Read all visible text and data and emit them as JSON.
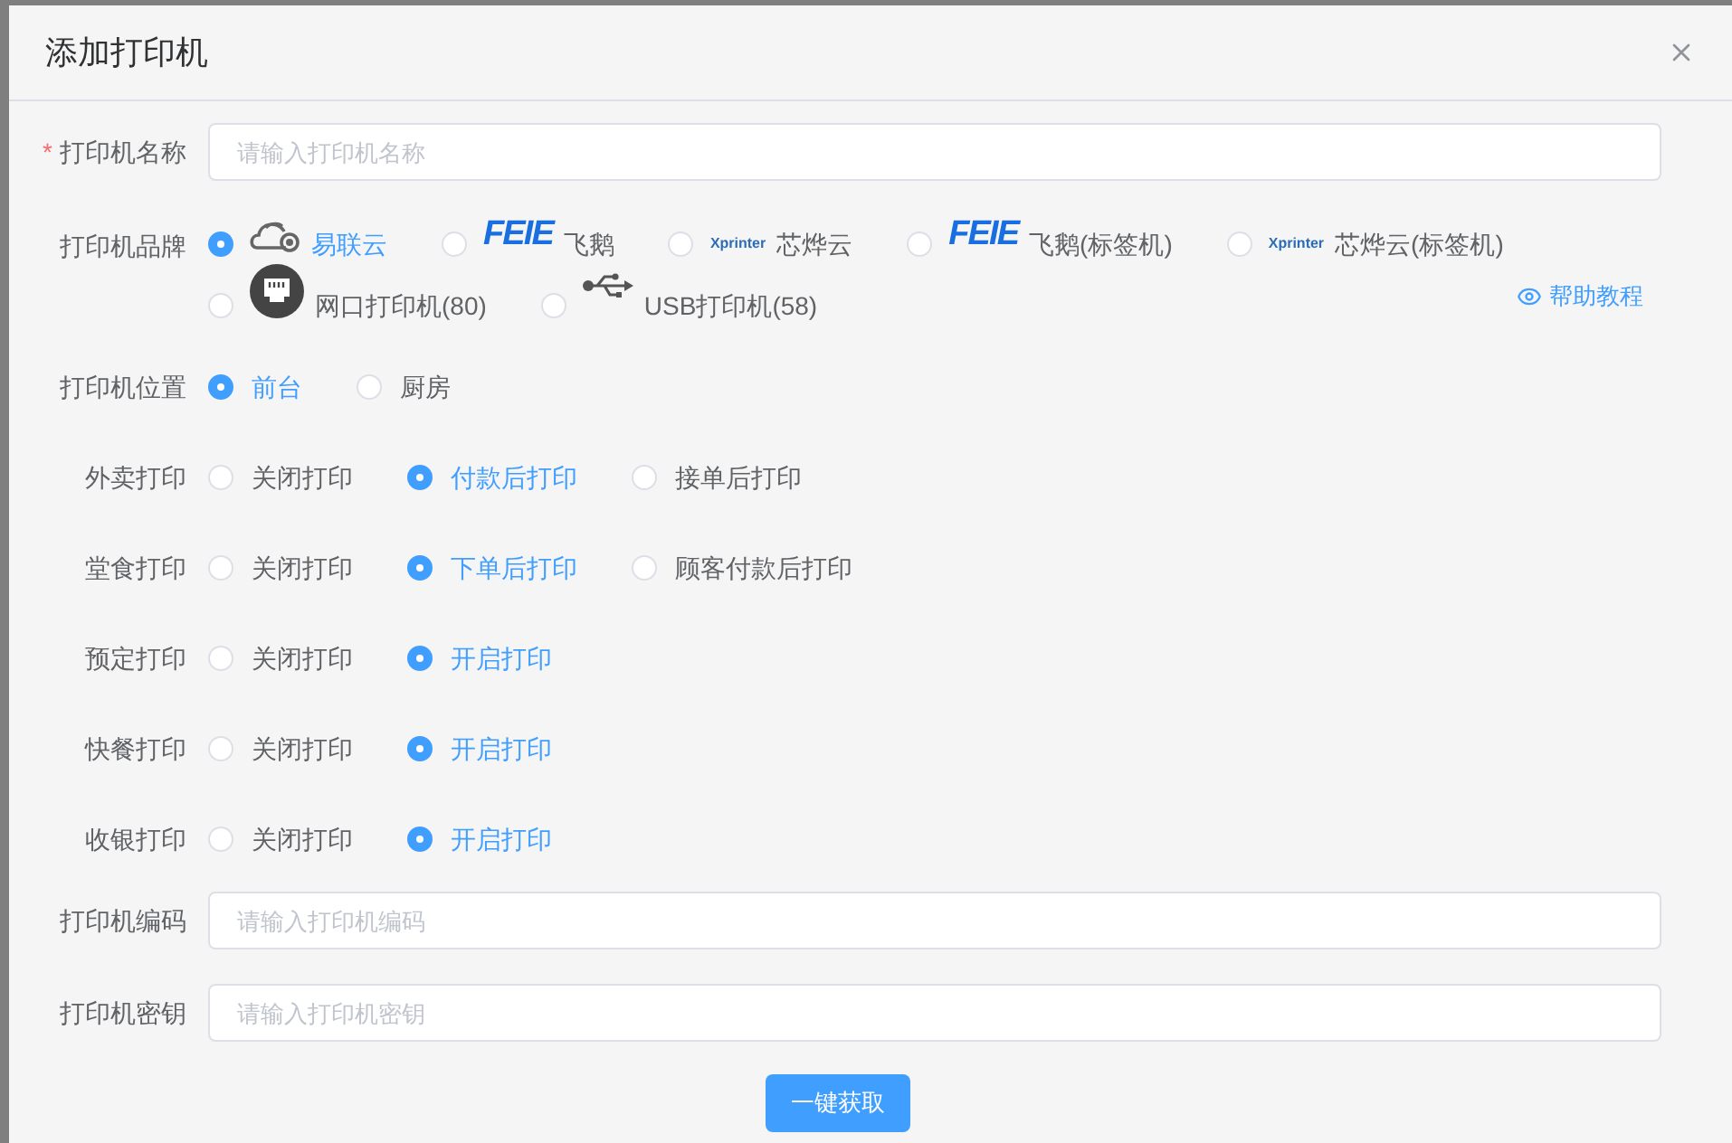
{
  "dialog": {
    "title": "添加打印机"
  },
  "name_field": {
    "required_mark": "*",
    "label": "打印机名称",
    "placeholder": "请输入打印机名称"
  },
  "brand": {
    "label": "打印机品牌",
    "options": [
      {
        "kind": "cloud",
        "name": "易联云",
        "selected": true
      },
      {
        "kind": "feie",
        "logo": "FEIE",
        "name": "飞鹅",
        "selected": false
      },
      {
        "kind": "xprinter",
        "logo": "Xprinter",
        "name": "芯烨云",
        "selected": false
      },
      {
        "kind": "feie",
        "logo": "FEIE",
        "name": "飞鹅(标签机)",
        "selected": false
      },
      {
        "kind": "xprinter",
        "logo": "Xprinter",
        "name": "芯烨云(标签机)",
        "selected": false
      },
      {
        "kind": "ethernet",
        "name": "网口打印机(80)",
        "selected": false
      },
      {
        "kind": "usb",
        "name": "USB打印机(58)",
        "selected": false
      }
    ],
    "help": "帮助教程"
  },
  "radio_groups": [
    {
      "label": "打印机位置",
      "options": [
        {
          "label": "前台",
          "selected": true
        },
        {
          "label": "厨房",
          "selected": false
        }
      ]
    },
    {
      "label": "外卖打印",
      "options": [
        {
          "label": "关闭打印",
          "selected": false
        },
        {
          "label": "付款后打印",
          "selected": true
        },
        {
          "label": "接单后打印",
          "selected": false
        }
      ]
    },
    {
      "label": "堂食打印",
      "options": [
        {
          "label": "关闭打印",
          "selected": false
        },
        {
          "label": "下单后打印",
          "selected": true
        },
        {
          "label": "顾客付款后打印",
          "selected": false
        }
      ]
    },
    {
      "label": "预定打印",
      "options": [
        {
          "label": "关闭打印",
          "selected": false
        },
        {
          "label": "开启打印",
          "selected": true
        }
      ]
    },
    {
      "label": "快餐打印",
      "options": [
        {
          "label": "关闭打印",
          "selected": false
        },
        {
          "label": "开启打印",
          "selected": true
        }
      ]
    },
    {
      "label": "收银打印",
      "options": [
        {
          "label": "关闭打印",
          "selected": false
        },
        {
          "label": "开启打印",
          "selected": true
        }
      ]
    }
  ],
  "code_field": {
    "label": "打印机编码",
    "placeholder": "请输入打印机编码"
  },
  "secret_field": {
    "label": "打印机密钥",
    "placeholder": "请输入打印机密钥"
  },
  "fetch_button": "一键获取"
}
